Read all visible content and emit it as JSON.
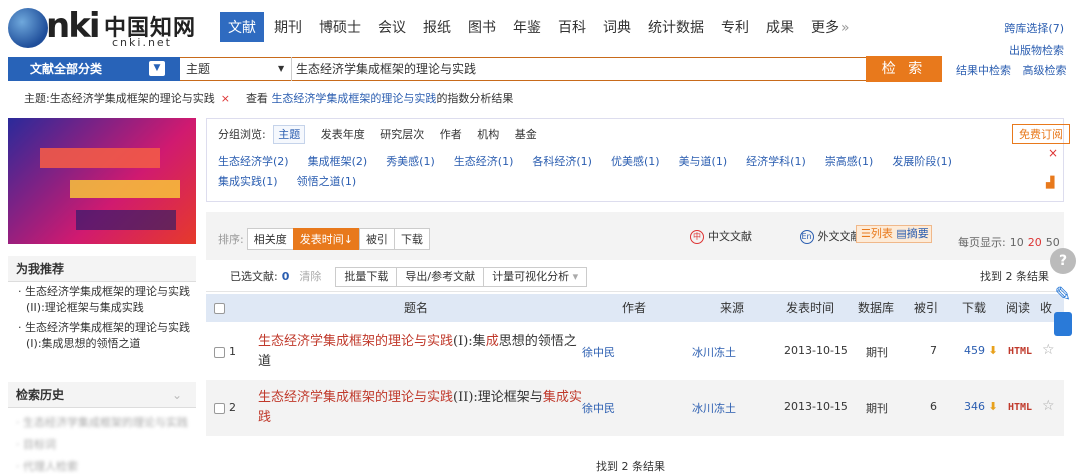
{
  "logo": {
    "brand": "nki",
    "chinese": "中国知网",
    "domain": "cnki.net"
  },
  "nav": {
    "items": [
      "文献",
      "期刊",
      "博硕士",
      "会议",
      "报纸",
      "图书",
      "年鉴",
      "百科",
      "词典",
      "统计数据",
      "专利",
      "成果",
      "更多"
    ],
    "active": 0
  },
  "top_links": {
    "cross_db": "跨库选择(7)",
    "pub_search": "出版物检索",
    "within_results": "结果中检索",
    "advanced": "高级检索"
  },
  "search": {
    "category": "文献全部分类",
    "field": "主题",
    "query": "生态经济学集成框架的理论与实践",
    "button": "检 索"
  },
  "hint": {
    "filter": "主题:生态经济学集成框架的理论与实践",
    "close": "×",
    "prefix": "查看",
    "link": "生态经济学集成框架的理论与实践",
    "suffix": "的指数分析结果"
  },
  "sidebar": {
    "recommend_title": "为我推荐",
    "recommend_items": [
      "生态经济学集成框架的理论与实践(II):理论框架与集成实践",
      "生态经济学集成框架的理论与实践(I):集成思想的领悟之道"
    ],
    "history_title": "检索历史",
    "history_items": [
      "生态经济学集成框架的理论与实践",
      "目标词",
      "代理人检索"
    ]
  },
  "group": {
    "label": "分组浏览:",
    "tabs": [
      "主题",
      "发表年度",
      "研究层次",
      "作者",
      "机构",
      "基金"
    ],
    "active": 0,
    "subscribe": "免费订阅",
    "tags": [
      "生态经济学(2)",
      "集成框架(2)",
      "秀美感(1)",
      "生态经济(1)",
      "各科经济(1)",
      "优美感(1)",
      "美与道(1)",
      "经济学科(1)",
      "崇高感(1)",
      "发展阶段(1)",
      "集成实践(1)",
      "领悟之道(1)"
    ],
    "close": "×"
  },
  "sort": {
    "label": "排序:",
    "options": [
      "相关度",
      "发表时间",
      "被引",
      "下载"
    ],
    "active": 1
  },
  "langs": {
    "zh": "中文文献",
    "en": "外文文献",
    "zh_icon": "中",
    "en_icon": "En"
  },
  "view": {
    "list": "列表",
    "abstract": "摘要"
  },
  "perpage": {
    "label": "每页显示:",
    "options": [
      "10",
      "20",
      "50"
    ],
    "active": 1
  },
  "selection": {
    "label": "已选文献:",
    "count": "0",
    "clear": "清除",
    "bulk": "批量下载",
    "export": "导出/参考文献",
    "viz": "计量可视化分析"
  },
  "found_top": "找到 2 条结果",
  "table": {
    "headers": {
      "title": "题名",
      "author": "作者",
      "source": "来源",
      "date": "发表时间",
      "db": "数据库",
      "cited": "被引",
      "download": "下载",
      "read": "阅读",
      "fav": "收"
    },
    "rows": [
      {
        "num": "1",
        "title_hl": "生态经济学集成框架的理论与实践",
        "title_mid": "(I):集",
        "title_hl2": "成",
        "title_rest": "思想的领悟之道",
        "author": "徐中民",
        "source": "冰川冻土",
        "date": "2013-10-15",
        "db": "期刊",
        "cited": "7",
        "downloads": "459",
        "read": "HTML"
      },
      {
        "num": "2",
        "title_hl": "生态经济学集成框架的理论与实践",
        "title_mid": "(II):理论框架与",
        "title_hl2": "集成实践",
        "title_rest": "",
        "author": "徐中民",
        "source": "冰川冻土",
        "date": "2013-10-15",
        "db": "期刊",
        "cited": "6",
        "downloads": "346",
        "read": "HTML"
      }
    ]
  },
  "found_bottom": "找到 2 条结果",
  "colors": {
    "accent_blue": "#2863b8",
    "accent_orange": "#e8791c",
    "highlight_red": "#c0392b"
  }
}
